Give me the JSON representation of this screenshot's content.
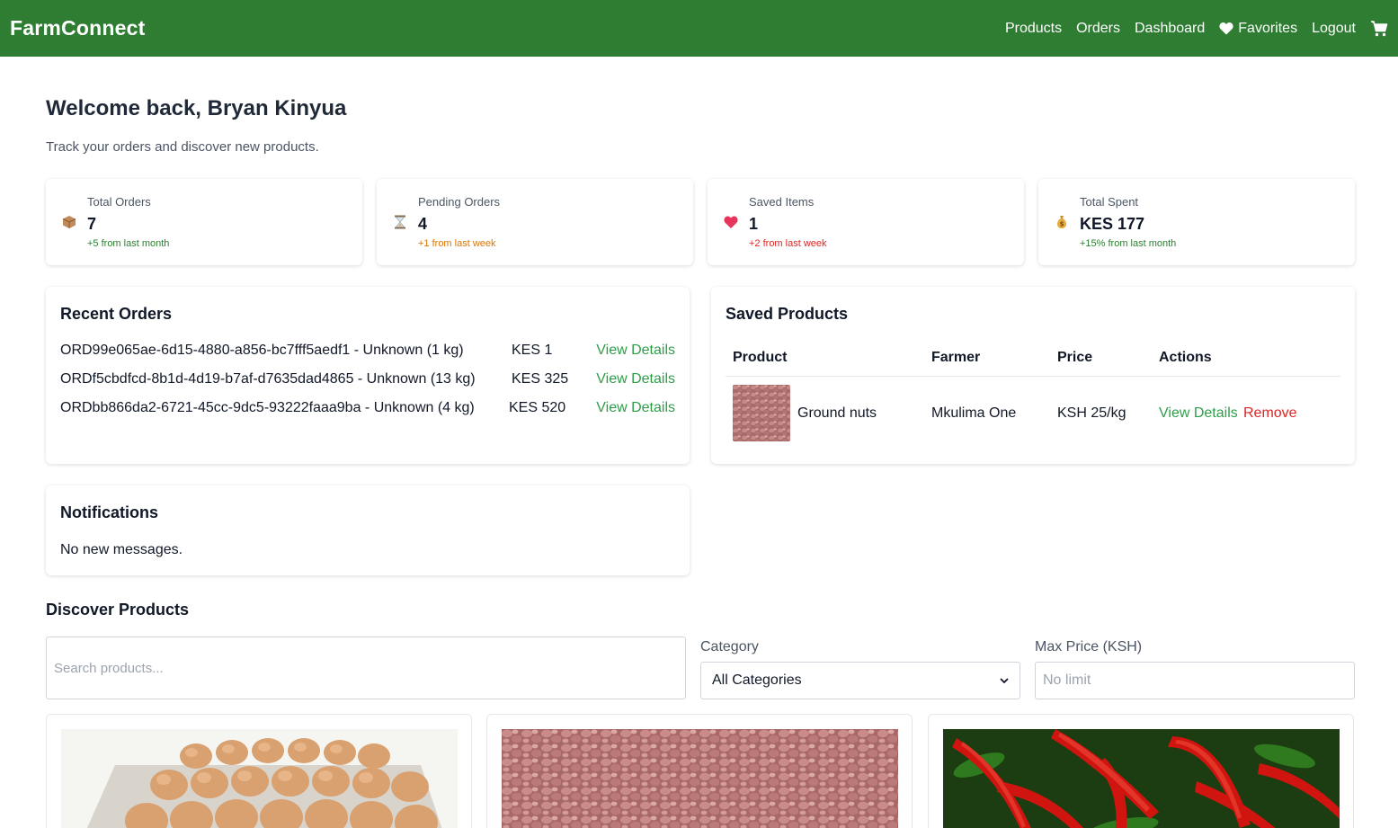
{
  "nav": {
    "brand": "FarmConnect",
    "links": [
      "Products",
      "Orders",
      "Dashboard",
      "Favorites",
      "Logout"
    ],
    "icons": {
      "favorites": "heart-icon",
      "cart": "cart-icon"
    }
  },
  "welcome": {
    "title": "Welcome back, Bryan Kinyua",
    "subtitle": "Track your orders and discover new products."
  },
  "stats": [
    {
      "label": "Total Orders",
      "value": "7",
      "delta": "+5 from last month",
      "icon": "package-icon",
      "delta_color": "#2e7d32"
    },
    {
      "label": "Pending Orders",
      "value": "4",
      "delta": "+1 from last week",
      "icon": "hourglass-icon",
      "delta_color": "#d97706"
    },
    {
      "label": "Saved Items",
      "value": "1",
      "delta": "+2 from last week",
      "icon": "heart-icon",
      "delta_color": "#dc2626"
    },
    {
      "label": "Total Spent",
      "value": "KES 177",
      "delta": "+15% from last month",
      "icon": "money-bag-icon",
      "delta_color": "#2e7d32"
    }
  ],
  "recent_orders": {
    "title": "Recent Orders",
    "rows": [
      {
        "text": "ORD99e065ae-6d15-4880-a856-bc7fff5aedf1 - Unknown (1 kg)",
        "amount": "KES 1",
        "action": "View Details"
      },
      {
        "text": "ORDf5cbdfcd-8b1d-4d19-b7af-d7635dad4865 - Unknown (13 kg)",
        "amount": "KES 325",
        "action": "View Details"
      },
      {
        "text": "ORDbb866da2-6721-45cc-9dc5-93222faaa9ba - Unknown (4 kg)",
        "amount": "KES 520",
        "action": "View Details"
      }
    ]
  },
  "saved_products": {
    "title": "Saved Products",
    "headers": [
      "Product",
      "Farmer",
      "Price",
      "Actions"
    ],
    "rows": [
      {
        "product": "Ground nuts",
        "farmer": "Mkulima One",
        "price": "KSH 25/kg",
        "view": "View Details",
        "remove": "Remove"
      }
    ]
  },
  "notifications": {
    "title": "Notifications",
    "message": "No new messages."
  },
  "discover": {
    "title": "Discover Products",
    "search_placeholder": "Search products...",
    "category_label": "Category",
    "category_value": "All Categories",
    "max_price_label": "Max Price (KSH)",
    "max_price_placeholder": "No limit"
  },
  "colors": {
    "brand_green": "#2e7d32",
    "link_green": "#2e9e49",
    "danger_red": "#dc2626",
    "pending_orange": "#d97706"
  }
}
